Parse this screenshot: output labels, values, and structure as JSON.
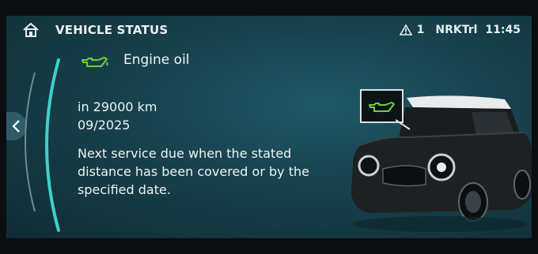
{
  "header": {
    "title": "VEHICLE STATUS",
    "warning_count": "1",
    "profile": "NRKTrl",
    "time": "11:45",
    "icons": [
      "home-icon",
      "warning-triangle-icon"
    ]
  },
  "content": {
    "item_icon": "oil-can-icon",
    "item_label": "Engine oil",
    "distance": "in 29000 km",
    "date": "09/2025",
    "description": "Next service due when the stated distance has been covered or by the specified date."
  },
  "colors": {
    "accent_green": "#6fcf3a",
    "screen_bg": "#17414c",
    "arc_cyan": "#3fd0c8"
  }
}
